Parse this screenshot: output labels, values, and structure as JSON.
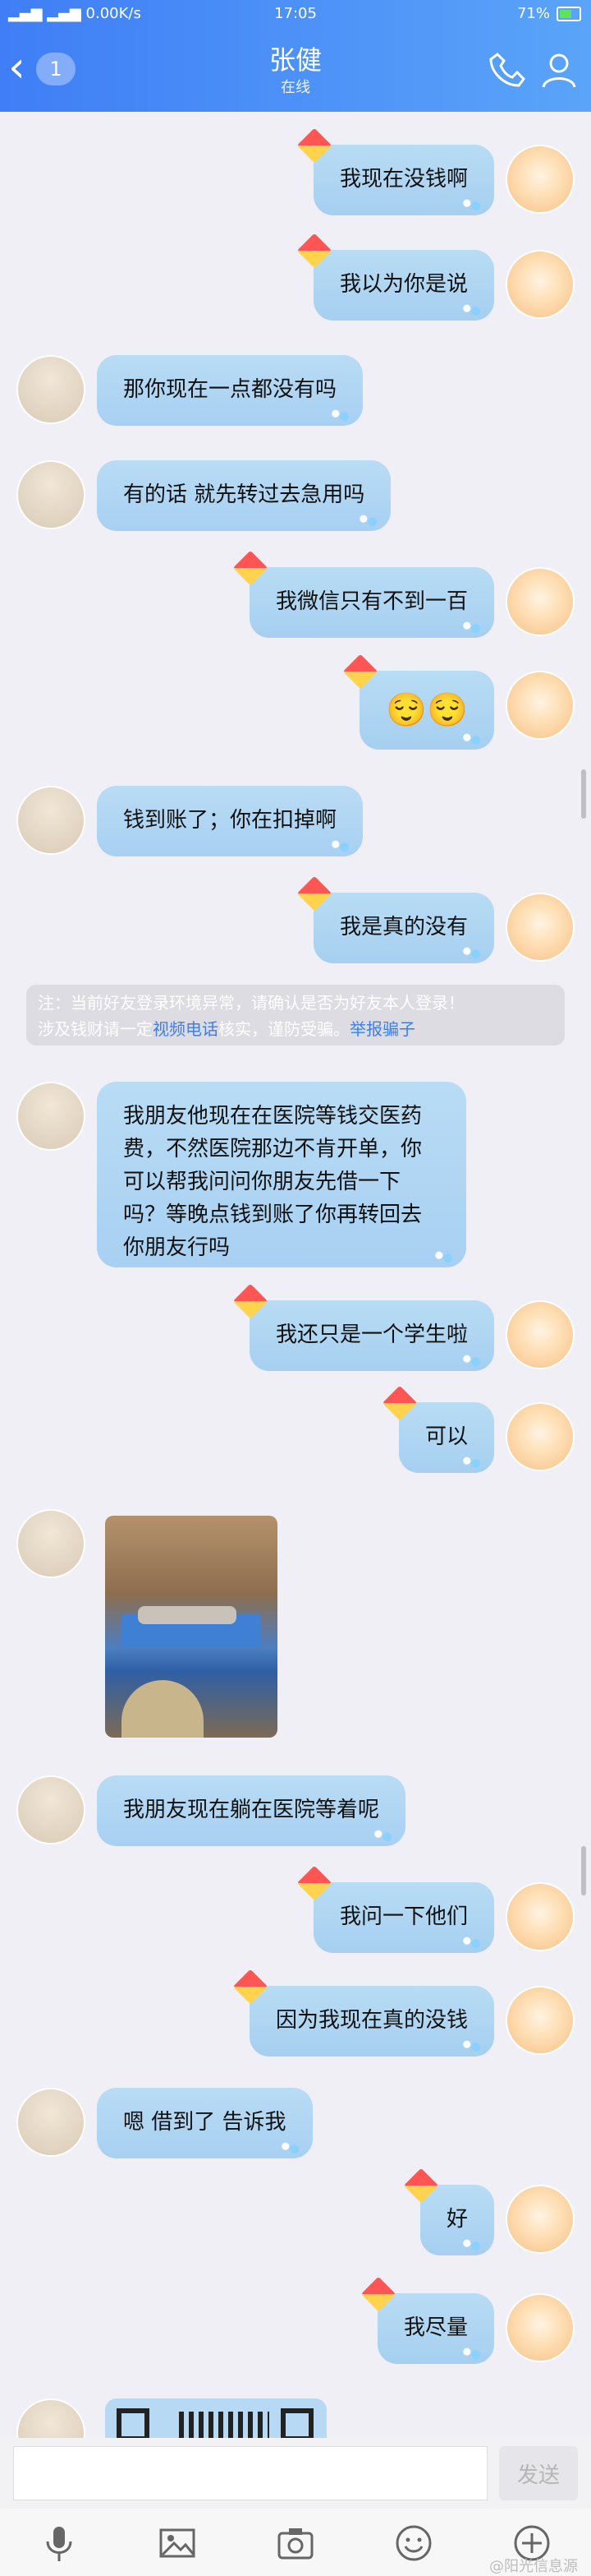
{
  "status_bar": {
    "signal": "▂▄▆ ▂▄▆",
    "speed": "0.00K/s",
    "time": "17:05",
    "battery": "71%"
  },
  "header": {
    "unread_count": "1",
    "contact_name": "张健",
    "contact_status": "在线"
  },
  "messages": [
    {
      "side": "me",
      "text": "我现在没钱啊"
    },
    {
      "side": "me",
      "text": "我以为你是说"
    },
    {
      "side": "friend",
      "text": "那你现在一点都没有吗"
    },
    {
      "side": "friend",
      "text": "有的话 就先转过去急用吗"
    },
    {
      "side": "me",
      "text": "我微信只有不到一百"
    },
    {
      "side": "me",
      "text": "😌😌"
    },
    {
      "side": "friend",
      "text": "钱到账了；你在扣掉啊"
    },
    {
      "side": "me",
      "text": "我是真的没有"
    },
    {
      "side": "friend",
      "text": "我朋友他现在在医院等钱交医药费，不然医院那边不肯开单，你可以帮我问问你朋友先借一下吗？等晚点钱到账了你再转回去你朋友行吗"
    },
    {
      "side": "me",
      "text": "我还只是一个学生啦"
    },
    {
      "side": "me",
      "text": "可以"
    },
    {
      "side": "friend",
      "text": "我朋友现在躺在医院等着呢"
    },
    {
      "side": "me",
      "text": "我问一下他们"
    },
    {
      "side": "me",
      "text": "因为我现在真的没钱"
    },
    {
      "side": "friend",
      "text": "嗯 借到了 告诉我"
    },
    {
      "side": "me",
      "text": "好"
    },
    {
      "side": "me",
      "text": "我尽量"
    }
  ],
  "system_note": {
    "line1": "注：当前好友登录环境异常，请确认是否为好友本人登录！",
    "line2_pre": "涉及钱财请一定",
    "line2_link": "视频电话",
    "line2_mid": "核实，谨防受骗。",
    "line2_report": "举报骗子"
  },
  "input": {
    "placeholder": "",
    "send_label": "发送"
  },
  "watermark": "@阳光信息源"
}
